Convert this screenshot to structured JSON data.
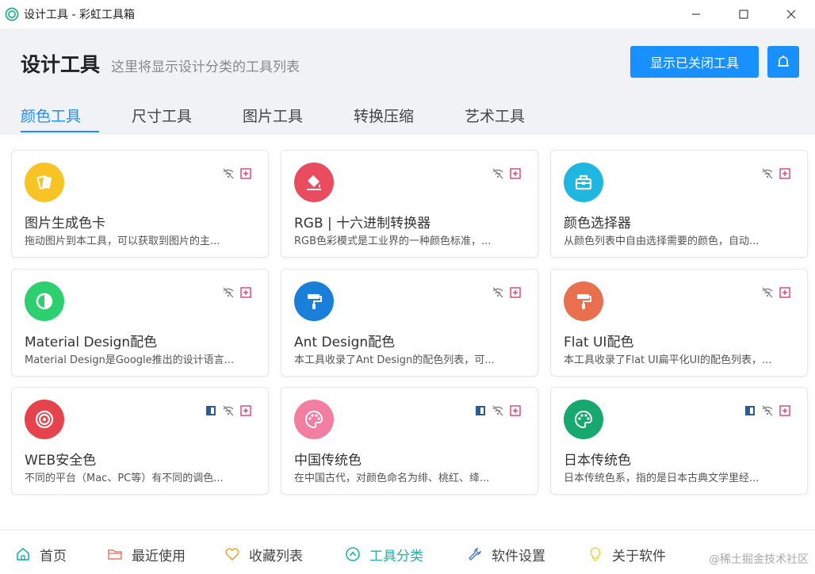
{
  "window": {
    "title": "设计工具 - 彩虹工具箱",
    "icon": "rainbow-app-icon"
  },
  "header": {
    "title": "设计工具",
    "subtitle": "这里将显示设计分类的工具列表",
    "show_closed_label": "显示已关闭工具"
  },
  "tabs": [
    {
      "label": "颜色工具",
      "active": true
    },
    {
      "label": "尺寸工具",
      "active": false
    },
    {
      "label": "图片工具",
      "active": false
    },
    {
      "label": "转换压缩",
      "active": false
    },
    {
      "label": "艺术工具",
      "active": false
    }
  ],
  "cards": [
    {
      "title": "图片生成色卡",
      "desc": "拖动图片到本工具，可以获取到图片的主...",
      "color": "#f7c325",
      "icon": "palette-cards-icon"
    },
    {
      "title": "RGB | 十六进制转换器",
      "desc": "RGB色彩模式是工业界的一种颜色标准，...",
      "color": "#e84c5e",
      "icon": "paint-bucket-icon"
    },
    {
      "title": "颜色选择器",
      "desc": "从颜色列表中自由选择需要的颜色，自动...",
      "color": "#1fb6e0",
      "icon": "toolbox-icon"
    },
    {
      "title": "Material Design配色",
      "desc": "Material Design是Google推出的设计语言...",
      "color": "#2dd06f",
      "icon": "half-circle-icon"
    },
    {
      "title": "Ant Design配色",
      "desc": "本工具收录了Ant Design的配色列表，可...",
      "color": "#1a7fd8",
      "icon": "paint-roller-icon"
    },
    {
      "title": "Flat UI配色",
      "desc": "本工具收录了Flat UI扁平化UI的配色列表，...",
      "color": "#e8704f",
      "icon": "paint-roller-icon"
    },
    {
      "title": "WEB安全色",
      "desc": "不同的平台（Mac、PC等）有不同的调色...",
      "color": "#e6434d",
      "icon": "target-icon"
    },
    {
      "title": "中国传统色",
      "desc": "在中国古代，对颜色命名为绯、桃红、绛...",
      "color": "#f27ea1",
      "icon": "palette-icon"
    },
    {
      "title": "日本传统色",
      "desc": "日本传统色系，指的是日本古典文学里经...",
      "color": "#17a86f",
      "icon": "palette-icon"
    }
  ],
  "nav": [
    {
      "label": "首页",
      "icon": "home-icon",
      "active": false
    },
    {
      "label": "最近使用",
      "icon": "folder-icon",
      "active": false
    },
    {
      "label": "收藏列表",
      "icon": "heart-icon",
      "active": false
    },
    {
      "label": "工具分类",
      "icon": "compass-icon",
      "active": true
    },
    {
      "label": "软件设置",
      "icon": "wrench-icon",
      "active": false
    },
    {
      "label": "关于软件",
      "icon": "lightbulb-icon",
      "active": false
    }
  ],
  "watermark": "@稀土掘金技术社区",
  "colors": {
    "accent": "#1890ff",
    "nav_active": "#19b4a8",
    "badge_pink": "#d4417a",
    "badge_blue": "#2f5b8f"
  }
}
